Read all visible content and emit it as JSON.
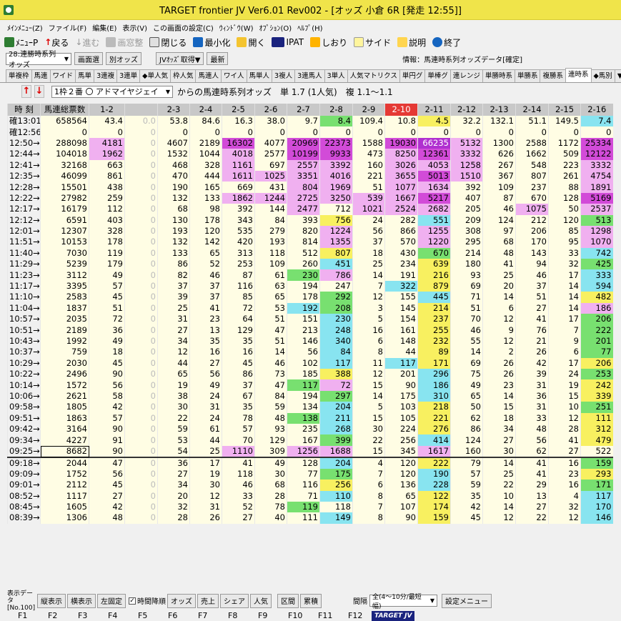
{
  "window": {
    "title": "TARGET frontier JV  Ver6.01  Rev002 - [オッズ 小倉 6R  [発走 12:55]]"
  },
  "menu": [
    "ﾒｲﾝﾒﾆｭｰ(Z)",
    "ファイル(F)",
    "編集(E)",
    "表示(V)",
    "この画面の設定(C)",
    "ｳｨﾝﾄﾞｳ(W)",
    "ｵﾌﾟｼｮﾝ(O)",
    "ﾍﾙﾌﾟ(H)"
  ],
  "toolbar": {
    "menu": "ﾒﾆｭｰP",
    "back": "戻る",
    "forward": "進む",
    "window_arrange": "画窓整",
    "close": "閉じる",
    "minimize": "最小化",
    "open": "開く",
    "ipat": "IPAT",
    "bookmark": "しおり",
    "side": "サイド",
    "help": "説明",
    "exit": "終了"
  },
  "row3": {
    "view_select": "28:連勝時系列オッズ",
    "btn_screen": "画面選",
    "btn_odds": "別オッズ",
    "btn_jv": "JVｵｯｽﾞ取得▼",
    "btn_latest": "最新",
    "info": "情報：馬連時系列オッズデータ[確定]"
  },
  "tabs": [
    "単複枠",
    "馬連",
    "ワイド",
    "馬単",
    "3連複",
    "3連単",
    "◆単人気",
    "枠人気",
    "馬連人",
    "ワイ人",
    "馬単人",
    "3複人",
    "3連馬人",
    "3単人",
    "人気マトリクス",
    "単円グ",
    "単棒グ",
    "連レンジ",
    "単勝時系",
    "単勝系",
    "複勝系",
    "連時系",
    "◆馬別",
    "▼連作成",
    "▼3連単作成",
    "▼3連単作成"
  ],
  "active_tab_index": 21,
  "horse": {
    "select": "1枠２番 〇 アドマイヤジェイ",
    "label": "からの馬連時系列オッズ　単 1.7 (1人気)　複 1.1～1.1"
  },
  "table": {
    "headers": [
      "時 刻",
      "馬連総票数",
      "1-2",
      "",
      "2-3",
      "2-4",
      "2-5",
      "2-6",
      "2-7",
      "2-8",
      "2-9",
      "2-10",
      "2-11",
      "2-12",
      "2-13",
      "2-14",
      "2-15",
      "2-16"
    ],
    "red_col": 11,
    "rows": [
      [
        "確13:01",
        "658564",
        "43.4",
        "0.0",
        "53.8",
        "84.6",
        "16.3",
        "38.0",
        "9.7",
        "8.4",
        "109.4",
        "10.8",
        "4.5",
        "32.2",
        "132.1",
        "51.1",
        "149.5",
        "7.4"
      ],
      [
        "確12:56",
        "0",
        "0",
        "0",
        "0",
        "0",
        "0",
        "0",
        "0",
        "0",
        "0",
        "0",
        "0",
        "0",
        "0",
        "0",
        "0",
        "0"
      ],
      [
        "12:50→",
        "288098",
        "4181",
        "0",
        "4607",
        "2189",
        "16302",
        "4077",
        "20969",
        "22373",
        "1588",
        "19030",
        "66235",
        "5132",
        "1300",
        "2588",
        "1172",
        "25334"
      ],
      [
        "12:44→",
        "104018",
        "1962",
        "0",
        "1532",
        "1044",
        "4018",
        "2577",
        "10199",
        "9933",
        "473",
        "8250",
        "12361",
        "3332",
        "626",
        "1662",
        "509",
        "12122"
      ],
      [
        "12:41→",
        "32168",
        "663",
        "0",
        "468",
        "328",
        "1161",
        "697",
        "2557",
        "3392",
        "160",
        "3026",
        "4053",
        "1258",
        "267",
        "548",
        "223",
        "3332"
      ],
      [
        "12:35→",
        "46099",
        "861",
        "0",
        "470",
        "444",
        "1611",
        "1025",
        "3351",
        "4016",
        "221",
        "3655",
        "5013",
        "1510",
        "367",
        "807",
        "261",
        "4754"
      ],
      [
        "12:28→",
        "15501",
        "438",
        "0",
        "190",
        "165",
        "669",
        "431",
        "804",
        "1969",
        "51",
        "1077",
        "1634",
        "392",
        "109",
        "237",
        "88",
        "1891"
      ],
      [
        "12:22→",
        "27982",
        "259",
        "0",
        "132",
        "133",
        "1862",
        "1244",
        "2725",
        "3250",
        "539",
        "1667",
        "5217",
        "407",
        "87",
        "670",
        "128",
        "5169"
      ],
      [
        "12:17→",
        "16179",
        "112",
        "0",
        "68",
        "98",
        "392",
        "144",
        "2477",
        "712",
        "1021",
        "2524",
        "2682",
        "205",
        "46",
        "1075",
        "50",
        "2537"
      ],
      [
        "12:12→",
        "6591",
        "403",
        "0",
        "130",
        "178",
        "343",
        "84",
        "393",
        "756",
        "24",
        "282",
        "551",
        "209",
        "124",
        "212",
        "120",
        "513"
      ],
      [
        "12:01→",
        "12307",
        "328",
        "0",
        "193",
        "120",
        "535",
        "279",
        "820",
        "1224",
        "56",
        "866",
        "1255",
        "308",
        "97",
        "206",
        "85",
        "1298"
      ],
      [
        "11:51→",
        "10153",
        "178",
        "0",
        "132",
        "142",
        "420",
        "193",
        "814",
        "1355",
        "37",
        "570",
        "1220",
        "295",
        "68",
        "170",
        "95",
        "1070"
      ],
      [
        "11:40→",
        "7030",
        "119",
        "0",
        "133",
        "65",
        "313",
        "118",
        "512",
        "807",
        "18",
        "430",
        "670",
        "214",
        "48",
        "143",
        "33",
        "742"
      ],
      [
        "11:29→",
        "5239",
        "179",
        "0",
        "86",
        "52",
        "253",
        "109",
        "260",
        "451",
        "25",
        "234",
        "639",
        "180",
        "41",
        "94",
        "32",
        "425"
      ],
      [
        "11:23→",
        "3112",
        "49",
        "0",
        "82",
        "46",
        "87",
        "61",
        "230",
        "786",
        "14",
        "191",
        "216",
        "93",
        "25",
        "46",
        "17",
        "333"
      ],
      [
        "11:17→",
        "3395",
        "57",
        "0",
        "37",
        "37",
        "116",
        "63",
        "194",
        "247",
        "7",
        "322",
        "879",
        "69",
        "20",
        "37",
        "14",
        "594"
      ],
      [
        "11:10→",
        "2583",
        "45",
        "0",
        "39",
        "37",
        "85",
        "65",
        "178",
        "292",
        "12",
        "155",
        "445",
        "71",
        "14",
        "51",
        "14",
        "482"
      ],
      [
        "11:04→",
        "1837",
        "51",
        "0",
        "25",
        "41",
        "72",
        "53",
        "192",
        "208",
        "3",
        "145",
        "214",
        "51",
        "6",
        "27",
        "14",
        "186"
      ],
      [
        "10:57→",
        "2035",
        "72",
        "0",
        "31",
        "23",
        "64",
        "51",
        "151",
        "230",
        "5",
        "154",
        "237",
        "70",
        "12",
        "41",
        "17",
        "206"
      ],
      [
        "10:51→",
        "2189",
        "36",
        "0",
        "27",
        "13",
        "129",
        "47",
        "213",
        "248",
        "16",
        "161",
        "255",
        "46",
        "9",
        "76",
        "7",
        "222"
      ],
      [
        "10:43→",
        "1992",
        "49",
        "0",
        "34",
        "35",
        "35",
        "51",
        "146",
        "340",
        "6",
        "148",
        "232",
        "55",
        "12",
        "21",
        "9",
        "201"
      ],
      [
        "10:37→",
        "759",
        "18",
        "0",
        "12",
        "16",
        "16",
        "14",
        "56",
        "84",
        "8",
        "44",
        "89",
        "14",
        "2",
        "26",
        "6",
        "77"
      ],
      [
        "10:29→",
        "2030",
        "45",
        "0",
        "44",
        "27",
        "45",
        "46",
        "102",
        "117",
        "11",
        "117",
        "171",
        "69",
        "26",
        "42",
        "17",
        "206"
      ],
      [
        "10:22→",
        "2496",
        "90",
        "0",
        "65",
        "56",
        "86",
        "73",
        "185",
        "388",
        "12",
        "201",
        "296",
        "75",
        "26",
        "39",
        "24",
        "253"
      ],
      [
        "10:14→",
        "1572",
        "56",
        "0",
        "19",
        "49",
        "37",
        "47",
        "117",
        "72",
        "15",
        "90",
        "186",
        "49",
        "23",
        "31",
        "19",
        "242"
      ],
      [
        "10:06→",
        "2621",
        "58",
        "0",
        "38",
        "24",
        "67",
        "84",
        "194",
        "297",
        "14",
        "175",
        "310",
        "65",
        "14",
        "36",
        "15",
        "339"
      ],
      [
        "09:58→",
        "1805",
        "42",
        "0",
        "30",
        "31",
        "35",
        "59",
        "134",
        "204",
        "5",
        "103",
        "218",
        "50",
        "15",
        "31",
        "10",
        "251"
      ],
      [
        "09:51→",
        "1863",
        "57",
        "0",
        "22",
        "24",
        "78",
        "48",
        "138",
        "211",
        "15",
        "105",
        "221",
        "62",
        "18",
        "33",
        "12",
        "111"
      ],
      [
        "09:42→",
        "3164",
        "90",
        "0",
        "59",
        "61",
        "57",
        "93",
        "235",
        "268",
        "30",
        "224",
        "276",
        "86",
        "34",
        "48",
        "28",
        "312"
      ],
      [
        "09:34→",
        "4227",
        "91",
        "0",
        "53",
        "44",
        "70",
        "129",
        "167",
        "399",
        "22",
        "256",
        "414",
        "124",
        "27",
        "56",
        "41",
        "479"
      ],
      [
        "09:25→",
        "8682",
        "90",
        "0",
        "54",
        "25",
        "1110",
        "309",
        "1256",
        "1688",
        "15",
        "345",
        "1617",
        "160",
        "30",
        "62",
        "27",
        "522"
      ],
      [
        "09:18→",
        "2044",
        "47",
        "0",
        "36",
        "17",
        "41",
        "49",
        "128",
        "204",
        "4",
        "120",
        "222",
        "79",
        "14",
        "41",
        "16",
        "159"
      ],
      [
        "09:09→",
        "1752",
        "56",
        "0",
        "27",
        "19",
        "118",
        "30",
        "77",
        "175",
        "7",
        "120",
        "190",
        "57",
        "25",
        "41",
        "23",
        "293"
      ],
      [
        "09:01→",
        "2112",
        "45",
        "0",
        "34",
        "30",
        "46",
        "68",
        "116",
        "256",
        "6",
        "136",
        "228",
        "59",
        "22",
        "29",
        "16",
        "171"
      ],
      [
        "08:52→",
        "1117",
        "27",
        "0",
        "20",
        "12",
        "33",
        "28",
        "71",
        "110",
        "8",
        "65",
        "122",
        "35",
        "10",
        "13",
        "4",
        "117"
      ],
      [
        "08:45→",
        "1605",
        "42",
        "0",
        "32",
        "31",
        "52",
        "78",
        "119",
        "118",
        "7",
        "107",
        "174",
        "42",
        "14",
        "27",
        "32",
        "170"
      ],
      [
        "08:39→",
        "1306",
        "48",
        "0",
        "28",
        "26",
        "27",
        "40",
        "111",
        "149",
        "8",
        "90",
        "159",
        "45",
        "12",
        "22",
        "12",
        "146"
      ]
    ],
    "colors": {
      "magenta": "#d24bd8",
      "pink": "#f0b0f0",
      "green": "#78e070",
      "yellow": "#f8f060",
      "cyan": "#88e4f0",
      "purple": "#b030d0"
    }
  },
  "bottom": {
    "display_data": "表示データ",
    "no": "[No.100]",
    "btn_vertical": "縦表示",
    "btn_horizontal": "横表示",
    "btn_fixed": "左固定",
    "chk_time_reverse": "時間降順",
    "btn_odds": "オッズ",
    "btn_sales": "売上",
    "btn_share": "シェア",
    "btn_pop": "人気",
    "btn_section": "区間",
    "btn_cumulative": "累積",
    "interval_label": "間隔",
    "interval_select": "全(4～10分/最短幅)",
    "btn_settings": "設定メニュー"
  },
  "fkeys": [
    "F1",
    "F2",
    "F3",
    "F4",
    "F5",
    "F6",
    "F7",
    "F8",
    "F9",
    "F10",
    "F11",
    "F12"
  ],
  "logo": "TARGET JV"
}
